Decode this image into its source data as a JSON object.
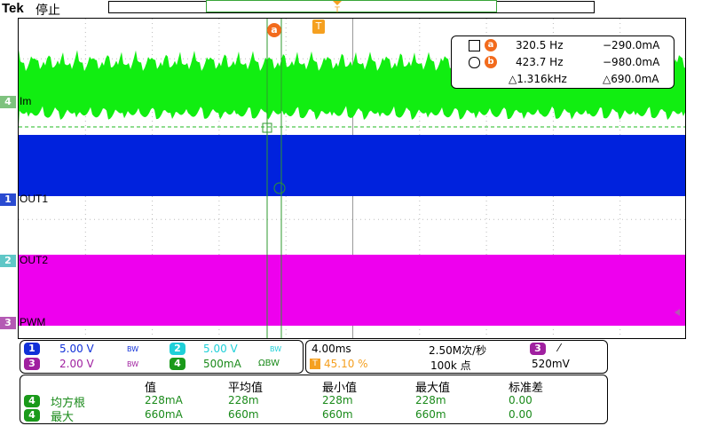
{
  "header": {
    "brand": "Tek",
    "status": "停止",
    "trigger_marker": "T"
  },
  "cursors": {
    "a_label": "a",
    "trigger_label": "T"
  },
  "channels": [
    {
      "num": "4",
      "label": "Im",
      "color": "#00ee00"
    },
    {
      "num": "1",
      "label": "OUT1",
      "color": "#0022dd"
    },
    {
      "num": "2",
      "label": "OUT2",
      "color": "#11cccc"
    },
    {
      "num": "3",
      "label": "PWM",
      "color": "#dd00dd"
    }
  ],
  "cursor_readout": {
    "a_freq": "320.5 Hz",
    "a_val": "−290.0mA",
    "b_freq": "423.7 Hz",
    "b_val": "−980.0mA",
    "delta_freq": "△1.316kHz",
    "delta_val": "△690.0mA",
    "a_tag": "a",
    "b_tag": "b"
  },
  "vertical_settings": {
    "ch1": {
      "num": "1",
      "scale": "5.00 V",
      "bw": "BW"
    },
    "ch2": {
      "num": "2",
      "scale": "5.00 V",
      "bw": "BW"
    },
    "ch3": {
      "num": "3",
      "scale": "2.00 V",
      "bw": "BW"
    },
    "ch4": {
      "num": "4",
      "scale": "500mA",
      "bw": "ΩBW"
    }
  },
  "horizontal": {
    "timebase": "4.00ms",
    "sample_rate": "2.50M次/秒",
    "trig_source": "3",
    "trig_slope": "⁄",
    "trig_position": "45.10 %",
    "record_length": "100k 点",
    "trig_level": "520mV"
  },
  "measurements": {
    "headers": [
      "值",
      "平均值",
      "最小值",
      "最大值",
      "标准差"
    ],
    "rows": [
      {
        "ch": "4",
        "name": "均方根",
        "values": [
          "228mA",
          "228m",
          "228m",
          "228m",
          "0.00"
        ]
      },
      {
        "ch": "4",
        "name": "最大",
        "values": [
          "660mA",
          "660m",
          "660m",
          "660m",
          "0.00"
        ]
      }
    ]
  }
}
